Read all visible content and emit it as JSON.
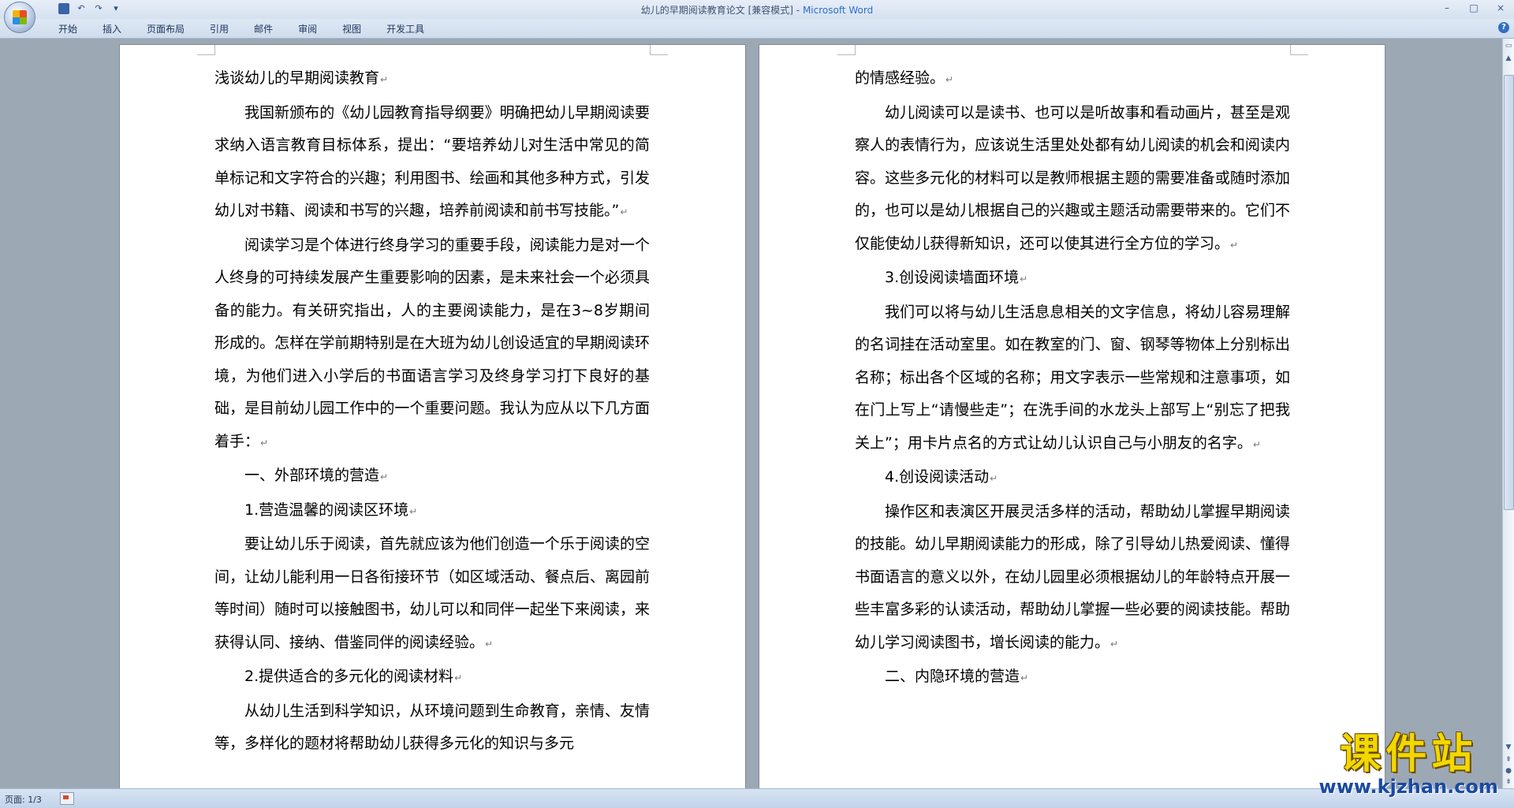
{
  "window": {
    "doc_name": "幼儿的早期阅读教育论文 [兼容模式]",
    "separator": " - ",
    "app_name": "Microsoft Word",
    "controls": {
      "minimize": "–",
      "maximize": "□",
      "close": "×"
    }
  },
  "quick_access": {
    "undo_icon": "↶",
    "redo_icon": "↷",
    "customize_icon": "▾"
  },
  "ribbon": {
    "tabs": [
      "开始",
      "插入",
      "页面布局",
      "引用",
      "邮件",
      "审阅",
      "视图",
      "开发工具"
    ],
    "help": "?"
  },
  "pages": {
    "left": [
      {
        "text": "浅谈幼儿的早期阅读教育",
        "indent": false
      },
      {
        "text": "我国新颁布的《幼儿园教育指导纲要》明确把幼儿早期阅读要求纳入语言教育目标体系，提出：“要培养幼儿对生活中常见的简单标记和文字符合的兴趣；利用图书、绘画和其他多种方式，引发幼儿对书籍、阅读和书写的兴趣，培养前阅读和前书写技能。”",
        "indent": true
      },
      {
        "text": "阅读学习是个体进行终身学习的重要手段，阅读能力是对一个人终身的可持续发展产生重要影响的因素，是未来社会一个必须具备的能力。有关研究指出，人的主要阅读能力，是在3~8岁期间形成的。怎样在学前期特别是在大班为幼儿创设适宜的早期阅读环境，为他们进入小学后的书面语言学习及终身学习打下良好的基础，是目前幼儿园工作中的一个重要问题。我认为应从以下几方面着手：",
        "indent": true
      },
      {
        "text": "一、外部环境的营造",
        "indent": true
      },
      {
        "text": "1.营造温馨的阅读区环境",
        "indent": true
      },
      {
        "text": "要让幼儿乐于阅读，首先就应该为他们创造一个乐于阅读的空间，让幼儿能利用一日各衔接环节（如区域活动、餐点后、离园前等时间）随时可以接触图书，幼儿可以和同伴一起坐下来阅读，来获得认同、接纳、借鉴同伴的阅读经验。",
        "indent": true
      },
      {
        "text": "2.提供适合的多元化的阅读材料",
        "indent": true
      },
      {
        "text": "从幼儿生活到科学知识，从环境问题到生命教育，亲情、友情等，多样化的题材将帮助幼儿获得多元化的知识与多元",
        "indent": true,
        "no_mark": true
      }
    ],
    "right": [
      {
        "text": "的情感经验。",
        "indent": false
      },
      {
        "text": "幼儿阅读可以是读书、也可以是听故事和看动画片，甚至是观察人的表情行为，应该说生活里处处都有幼儿阅读的机会和阅读内容。这些多元化的材料可以是教师根据主题的需要准备或随时添加的，也可以是幼儿根据自己的兴趣或主题活动需要带来的。它们不仅能使幼儿获得新知识，还可以使其进行全方位的学习。",
        "indent": true
      },
      {
        "text": "3.创设阅读墙面环境",
        "indent": true
      },
      {
        "text": "我们可以将与幼儿生活息息相关的文字信息，将幼儿容易理解的名词挂在活动室里。如在教室的门、窗、钢琴等物体上分别标出名称；标出各个区域的名称；用文字表示一些常规和注意事项，如在门上写上“请慢些走”；在洗手间的水龙头上部写上“别忘了把我关上”；用卡片点名的方式让幼儿认识自己与小朋友的名字。",
        "indent": true
      },
      {
        "text": "4.创设阅读活动",
        "indent": true
      },
      {
        "text": "操作区和表演区开展灵活多样的活动，帮助幼儿掌握早期阅读的技能。幼儿早期阅读能力的形成，除了引导幼儿热爱阅读、懂得书面语言的意义以外，在幼儿园里必须根据幼儿的年龄特点开展一些丰富多彩的认读活动，帮助幼儿掌握一些必要的阅读技能。帮助幼儿学习阅读图书，增长阅读的能力。",
        "indent": true
      },
      {
        "text": "二、内隐环境的营造",
        "indent": true
      }
    ],
    "paragraph_mark": "↵"
  },
  "status": {
    "page": "页面: 1/3"
  },
  "watermark": {
    "big": "课件站",
    "small": "www.kjzhan.com"
  },
  "colors": {
    "app_name": "#2d6ec9",
    "workspace": "#9da8b5",
    "watermark_yellow": "#f1d800",
    "watermark_blue": "#1a4aa0"
  }
}
